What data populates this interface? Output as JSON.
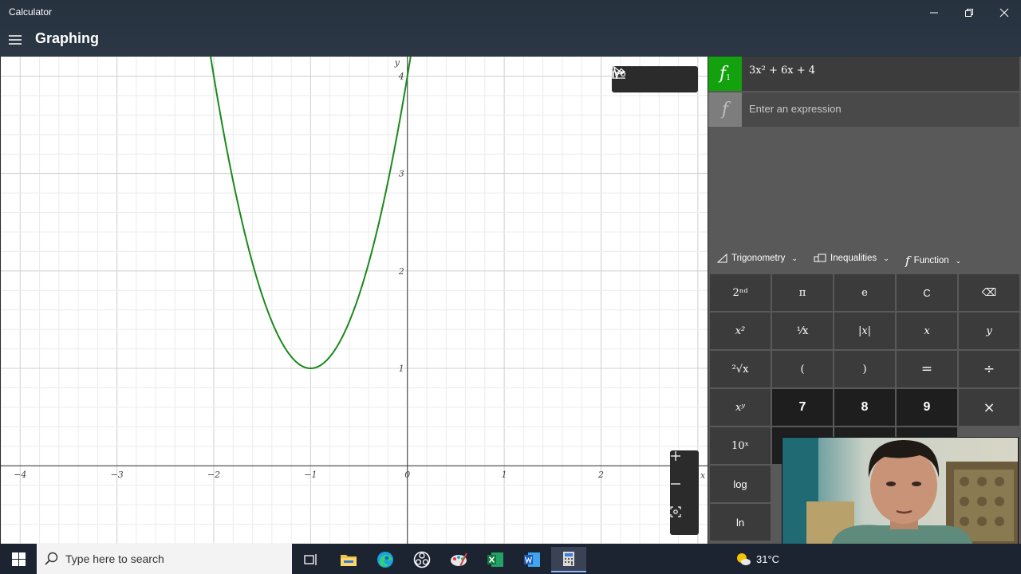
{
  "window": {
    "title": "Calculator",
    "mode": "Graphing"
  },
  "graph": {
    "x_ticks": [
      "−4",
      "−3",
      "−2",
      "−1",
      "0",
      "1",
      "2"
    ],
    "y_ticks": [
      "1",
      "2",
      "3",
      "4"
    ],
    "x_axis_label": "x",
    "y_axis_label": "y",
    "curve_color": "#1a8a1a",
    "function": {
      "a": 3,
      "b": 6,
      "c": 4
    },
    "x_range": [
      -4.2,
      3.1
    ],
    "y_range": [
      -0.8,
      4.2
    ]
  },
  "expressions": {
    "f1_badge": "f",
    "f1_subscript": "1",
    "f1_color": "#13a10e",
    "f1_text": "3x² + 6x + 4",
    "empty_badge": "f",
    "placeholder": "Enter an expression"
  },
  "categories": {
    "trig": "Trigonometry",
    "ineq": "Inequalities",
    "func": "Function"
  },
  "keypad": {
    "second": "2ⁿᵈ",
    "pi": "π",
    "e": "e",
    "clear": "C",
    "backspace": "⌫",
    "x_squared": "x²",
    "reciprocal": "¹⁄x",
    "abs": "|x|",
    "x": "x",
    "y": "y",
    "sqrt": "²√x",
    "lparen": "(",
    "rparen": ")",
    "equals": "=",
    "divide": "÷",
    "pow": "xʸ",
    "seven": "7",
    "eight": "8",
    "nine": "9",
    "multiply": "×",
    "ten_pow": "10ˣ",
    "log": "log",
    "ln": "ln"
  },
  "taskbar": {
    "search_placeholder": "Type here to search",
    "temperature": "31°C"
  }
}
